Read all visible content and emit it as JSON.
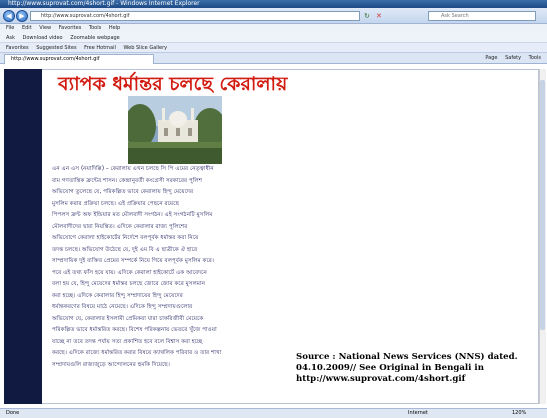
{
  "window": {
    "title": "http://www.suprovat.com/4short.gif - Windows Internet Explorer"
  },
  "address_bar": {
    "url": "http://www.suprovat.com/4short.gif",
    "search_placeholder": "Ask Search"
  },
  "menu": [
    "File",
    "Edit",
    "View",
    "Favorites",
    "Tools",
    "Help"
  ],
  "toolbar": {
    "items": [
      "Ask",
      "Download video",
      "Zoomable webpage"
    ]
  },
  "favorites_bar": {
    "items": [
      "Favorites",
      "Suggested Sites",
      "Free Hotmail",
      "Web Slice Gallery"
    ]
  },
  "tab": {
    "label": "http://www.suprovat.com/4short.gif",
    "tools": [
      "Page",
      "Safety",
      "Tools"
    ]
  },
  "article": {
    "headline": "ব্যাপক ধর্মান্তর চলছে কেরালায়",
    "paragraph_lines": [
      "এন এন এস (নয়াদিল্লি) – কেরালায় এখন চলছে সি পি এমের নেতৃত্বাধীন",
      "বাম গণতান্ত্রিক ফ্রন্টের শাসন। কেন্দ্রানুবর্তী কংগ্রেসী সরকারের পুলিশ",
      "অভিযোগ তুলেছে যে, পরিকল্পিত ভাবে কেরালায় হিন্দু মেয়েদের",
      "মুসলিম করার প্রক্রিয়া চলছে। এই প্রক্রিয়ার পেছনে রয়েছে",
      "পিপলস ফ্রন্ট অফ ইন্ডিয়ার মত মৌলবাদী সংগঠন। এই সংগঠনটি মুসলিম",
      "মৌলবাদীদের দ্বারা নিয়ন্ত্রিত। এদিকে কেরালার রাজ্য পুলিশের",
      "অভিযোগে কেরালা হাইকোর্টের নির্দেশে বলপূর্বক ধর্মান্তর করা নিয়ে",
      "তদন্ত চলছে। অভিযোগ উঠেছে যে, দুই এম বি এ ছাত্রীকে ঐ হারে",
      "সাম্প্রদায়িক দুই ব্যক্তির প্রেমের সম্পর্কে নিয়ে গিয়ে বলপূর্বক মুসলিম করে।",
      "পরে এই তথ্য ফাঁস হয়ে যায়। এদিকে কেরালা হাইকোর্টে এক আবেদনে",
      "বলা হয় যে, হিন্দু মেয়েদের ধর্মান্তর চলছে জোরে জোর করে মুসলমান",
      "করা হচ্ছে। এদিকে কেরালার হিন্দু সম্প্রদায়ের হিন্দু মেয়েদের",
      "ধর্মান্তকরণের বিষয়ে মাঠে নেমেছে। এদিকে হিন্দু সম্প্রদায়গুলোর",
      "অভিযোগ যে, কেরালার ইসলামী প্রেমিকরা যারা চাকরিজীবী মেয়েকে",
      "পরিকল্পিত ভাবে ধর্মান্তরিত করছে। বিশেষ পরিকল্পনায় ভেতরে খুঁজে পাওয়া",
      "যাচ্ছে না তবে তদন্ত পর্যায় সত্য প্রকাশিত হবে বলে বিশ্বাস করা হচ্ছে",
      "করছে। এদিকে রাজ্যে ধর্মান্তরিত করার বিষয়ে ক্যাথলিক পরিবার ও তার শাখা",
      "সম্প্রদায়গুলি রাজ্যজুড়ে আন্দোলনের হুমকি দিয়েছে।"
    ]
  },
  "source_note": {
    "lines": [
      "Source : National News Services (NNS) dated.",
      "04.10.2009//  See Original in Bengali in",
      "http://www.suprovat.com/4short.gif"
    ]
  },
  "status_bar": {
    "left": "Done",
    "zone": "Internet",
    "zoom": "120%"
  },
  "colors": {
    "headline": "#d21c12",
    "sidebar": "#111a40",
    "body_text": "#1a1a5c"
  }
}
